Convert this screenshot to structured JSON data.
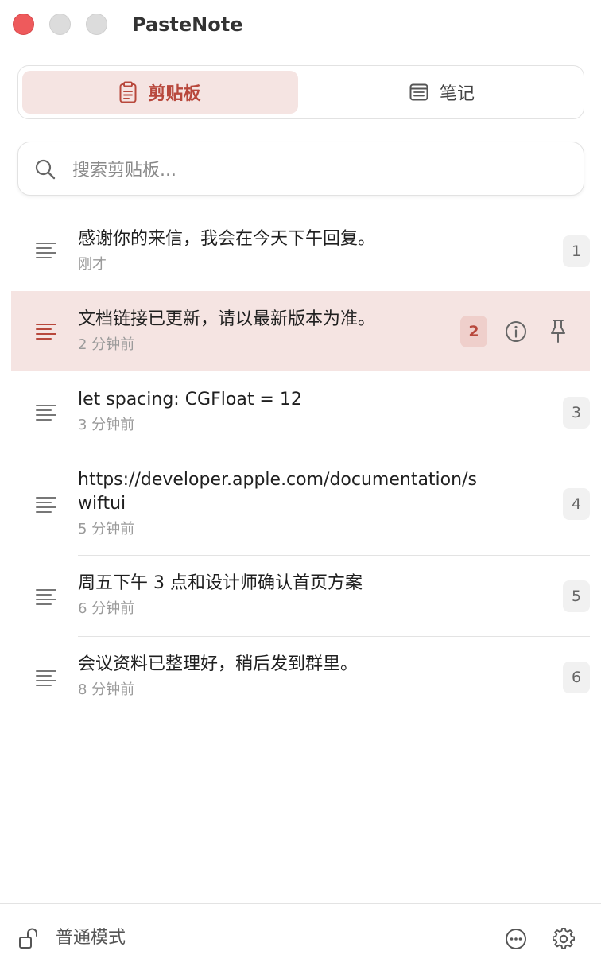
{
  "window": {
    "title": "PasteNote",
    "buttons": [
      "close",
      "minimize",
      "zoom"
    ]
  },
  "tabs": [
    {
      "label": "剪贴板",
      "icon": "clipboard-icon",
      "active": true
    },
    {
      "label": "笔记",
      "icon": "note-icon",
      "active": false
    }
  ],
  "search": {
    "placeholder": "搜索剪贴板...",
    "value": ""
  },
  "items": [
    {
      "text": "感谢你的来信，我会在今天下午回复。",
      "time": "刚才",
      "index": "1"
    },
    {
      "text": "文档链接已更新，请以最新版本为准。",
      "time": "2 分钟前",
      "index": "2",
      "selected": true
    },
    {
      "text": "let spacing: CGFloat = 12",
      "time": "3 分钟前",
      "index": "3"
    },
    {
      "text": "https://developer.apple.com/documentation/swiftui",
      "time": "5 分钟前",
      "index": "4"
    },
    {
      "text": "周五下午 3 点和设计师确认首页方案",
      "time": "6 分钟前",
      "index": "5"
    },
    {
      "text": "会议资料已整理好，稍后发到群里。",
      "time": "8 分钟前",
      "index": "6"
    }
  ],
  "footer": {
    "mode_label": "普通模式"
  },
  "colors": {
    "accent": "#b8483c",
    "accent_bg": "#f5e4e2",
    "close": "#ee5a5c"
  }
}
